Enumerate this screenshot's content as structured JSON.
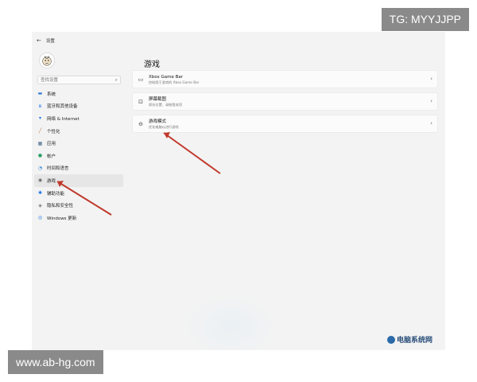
{
  "window": {
    "title": "设置"
  },
  "search": {
    "placeholder": "查找设置"
  },
  "sidebar": {
    "items": [
      {
        "label": "系统",
        "icon": "monitor-icon",
        "glyph": "▬",
        "color": "#2b7bd3"
      },
      {
        "label": "蓝牙和其他设备",
        "icon": "bluetooth-icon",
        "glyph": "ʙ",
        "color": "#1a73e8"
      },
      {
        "label": "网络 & Internet",
        "icon": "wifi-icon",
        "glyph": "▾",
        "color": "#1a73e8"
      },
      {
        "label": "个性化",
        "icon": "brush-icon",
        "glyph": "╱",
        "color": "#c27a3a"
      },
      {
        "label": "应用",
        "icon": "apps-icon",
        "glyph": "▦",
        "color": "#4a6a8a"
      },
      {
        "label": "帐户",
        "icon": "account-icon",
        "glyph": "●",
        "color": "#2aa06a"
      },
      {
        "label": "时间和语言",
        "icon": "clock-globe-icon",
        "glyph": "◔",
        "color": "#2b7bd3"
      },
      {
        "label": "游戏",
        "icon": "gamepad-icon",
        "glyph": "◉",
        "color": "#666666",
        "active": true
      },
      {
        "label": "辅助功能",
        "icon": "accessibility-icon",
        "glyph": "✱",
        "color": "#1a73e8"
      },
      {
        "label": "隐私和安全性",
        "icon": "shield-icon",
        "glyph": "◈",
        "color": "#777777"
      },
      {
        "label": "Windows 更新",
        "icon": "update-icon",
        "glyph": "◎",
        "color": "#1a73e8"
      }
    ]
  },
  "main": {
    "title": "游戏",
    "cards": [
      {
        "title": "Xbox Game Bar",
        "subtitle": "控制用于游戏的 Xbox Game Bar",
        "icon": "xbox-gamebar-icon",
        "glyph": "▭"
      },
      {
        "title": "屏幕截图",
        "subtitle": "保存位置、录制首选项",
        "icon": "capture-icon",
        "glyph": "⊡"
      },
      {
        "title": "游戏模式",
        "subtitle": "优化电脑以进行游戏",
        "icon": "game-mode-icon",
        "glyph": "⊖"
      }
    ],
    "chevron": "›"
  },
  "overlay": {
    "tg_label": "TG: MYYJJPP",
    "url_label": "www.ab-hg.com",
    "logo_text": "电脑系统网",
    "logo_color": "#2b6aa8",
    "arrow_color": "#c0392b"
  }
}
